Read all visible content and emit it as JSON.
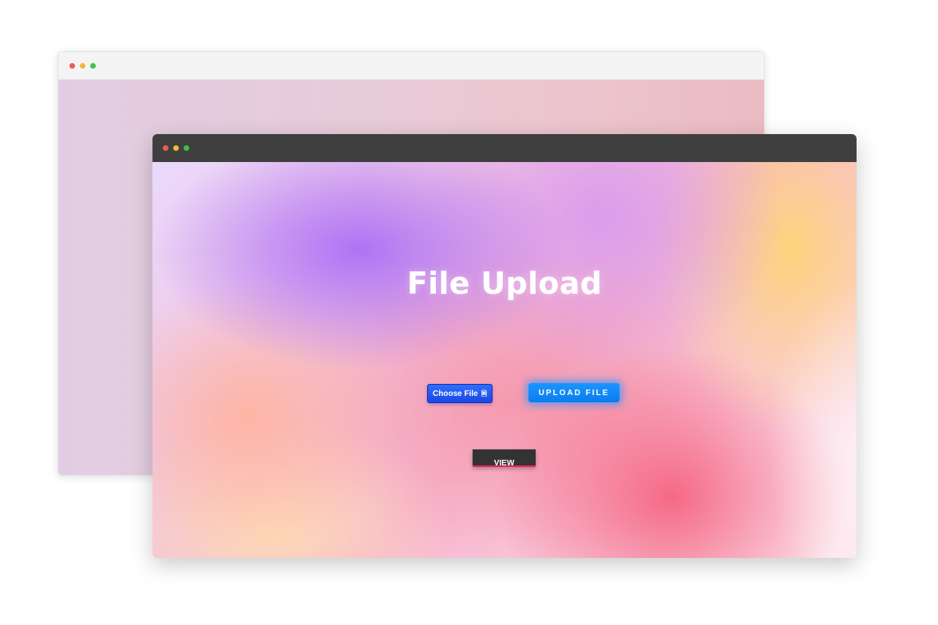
{
  "back_window": {
    "controls": [
      "close",
      "minimize",
      "maximize"
    ]
  },
  "front_window": {
    "controls": [
      "close",
      "minimize",
      "maximize"
    ],
    "page": {
      "title": "File Upload",
      "choose_file": {
        "label": "Choose File",
        "icon": "file-icon"
      },
      "upload_button": "UPLOAD FILE",
      "view_button": "VIEW"
    }
  },
  "colors": {
    "choose_file_bg": "#1b48e6",
    "upload_bg": "#0a7df0",
    "view_bg": "#333333",
    "view_underline": "#e0285a",
    "titlebar_dark": "#3f3f3f",
    "titlebar_light": "#f4f4f4"
  }
}
